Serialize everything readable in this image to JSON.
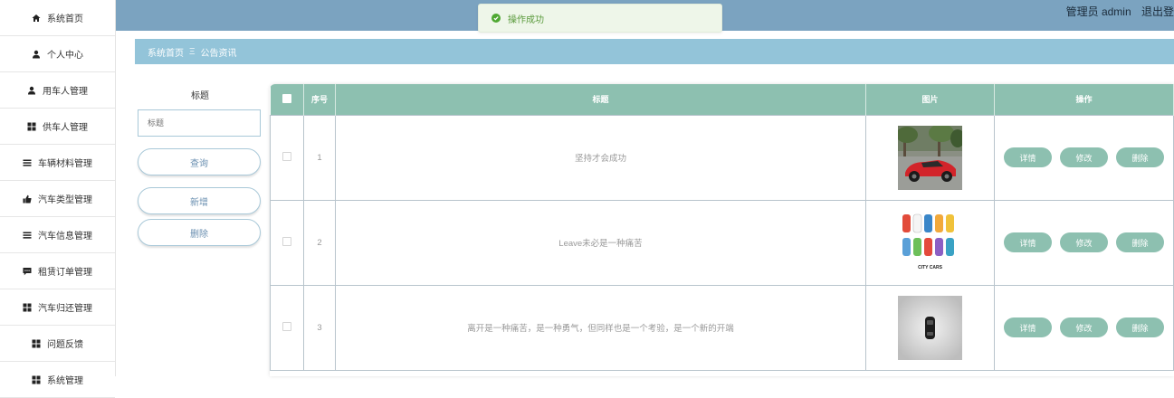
{
  "sidebar": {
    "items": [
      {
        "label": "系统首页",
        "icon": "home-icon"
      },
      {
        "label": "个人中心",
        "icon": "person-icon"
      },
      {
        "label": "用车人管理",
        "icon": "person-icon"
      },
      {
        "label": "供车人管理",
        "icon": "grid-icon"
      },
      {
        "label": "车辆材料管理",
        "icon": "list-icon"
      },
      {
        "label": "汽车类型管理",
        "icon": "thumbs-up-icon"
      },
      {
        "label": "汽车信息管理",
        "icon": "list-icon"
      },
      {
        "label": "租赁订单管理",
        "icon": "chat-icon"
      },
      {
        "label": "汽车归还管理",
        "icon": "grid-icon"
      },
      {
        "label": "问题反馈",
        "icon": "grid-icon"
      },
      {
        "label": "系统管理",
        "icon": "grid-icon"
      }
    ]
  },
  "header": {
    "user_label": "管理员 admin",
    "logout_label": "退出登"
  },
  "toast": {
    "message": "操作成功"
  },
  "breadcrumb": {
    "home": "系统首页",
    "separator": "Ξ",
    "current": "公告资讯"
  },
  "search": {
    "label": "标题",
    "placeholder": "标题",
    "query_button": "查询",
    "add_button": "新增",
    "delete_button": "删除"
  },
  "table": {
    "headers": {
      "index": "序号",
      "title": "标题",
      "picture": "图片",
      "actions": "操作"
    },
    "actions": {
      "detail": "详情",
      "edit": "修改",
      "delete": "删除"
    },
    "rows": [
      {
        "index": "1",
        "title": "坚持才会成功",
        "image": "red-sports-car-image"
      },
      {
        "index": "2",
        "title": "Leave未必是一种痛苦",
        "image": "city-cars-image"
      },
      {
        "index": "3",
        "title": "离开是一种痛苦，是一种勇气，但同样也是一个考验，是一个新的开端",
        "image": "car-topview-image"
      }
    ],
    "image_captions": {
      "city_cars": "CITY CARS"
    }
  },
  "colors": {
    "topbar": "#7ba3c0",
    "breadcrumb": "#93c4d9",
    "table_header": "#8dc0b0",
    "toast_text": "#5a9a3c"
  }
}
